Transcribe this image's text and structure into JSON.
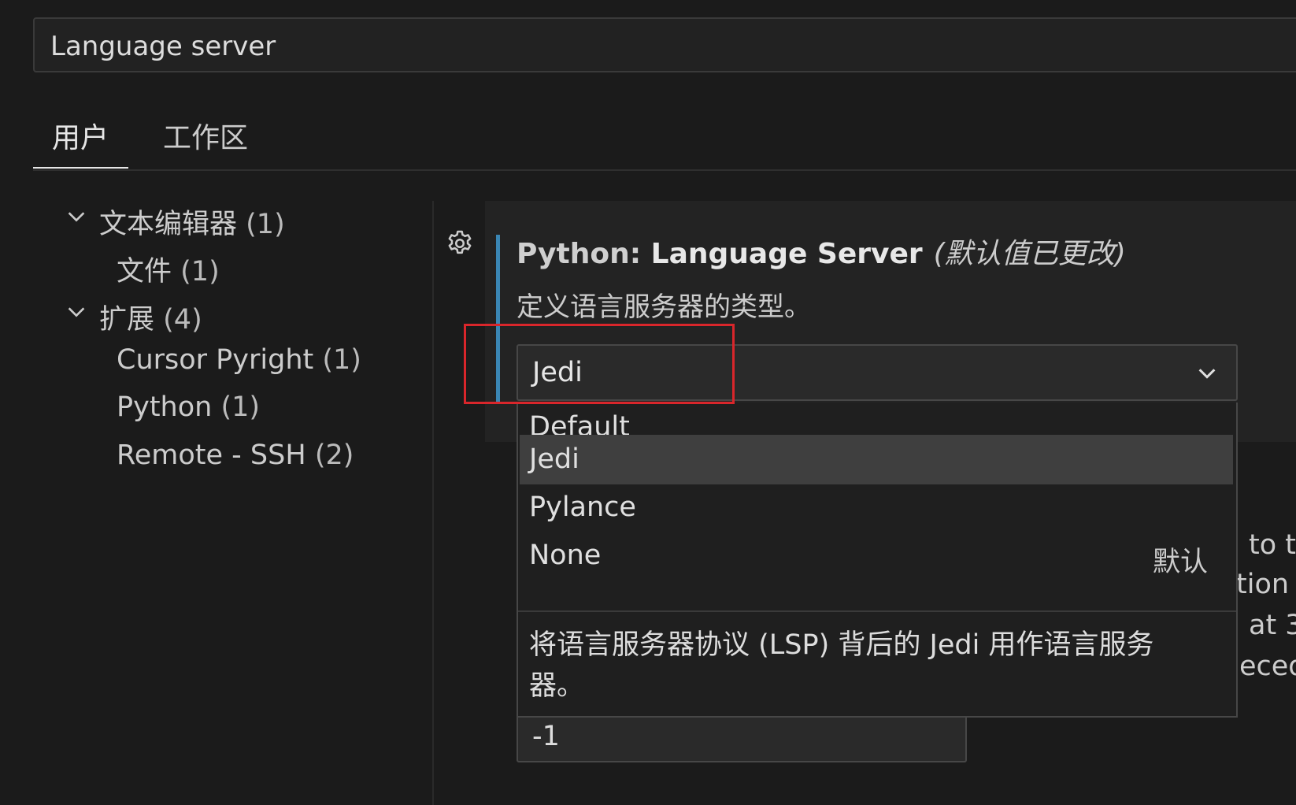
{
  "search": {
    "value": "Language server"
  },
  "tabs": [
    {
      "label": "用户",
      "active": true
    },
    {
      "label": "工作区",
      "active": false
    }
  ],
  "toc": {
    "groups": [
      {
        "label": "文本编辑器",
        "count": "(1)",
        "children": [
          {
            "label": "文件",
            "count": "(1)"
          }
        ]
      },
      {
        "label": "扩展",
        "count": "(4)",
        "children": [
          {
            "label": "Cursor Pyright",
            "count": "(1)"
          },
          {
            "label": "Python",
            "count": "(1)"
          },
          {
            "label": "Remote - SSH",
            "count": "(2)"
          }
        ]
      }
    ]
  },
  "setting": {
    "category": "Python: ",
    "name": "Language Server",
    "modified": "(默认值已更改)",
    "description": "定义语言服务器的类型。",
    "selected": "Jedi",
    "options": [
      {
        "label": "Default",
        "tag": ""
      },
      {
        "label": "Jedi",
        "tag": ""
      },
      {
        "label": "Pylance",
        "tag": ""
      },
      {
        "label": "None",
        "tag": "默认"
      }
    ],
    "selected_description": "将语言服务器协议 (LSP) 背后的 Jedi 用作语言服务器。"
  },
  "background": {
    "fragments": [
      "to t",
      "tion",
      "at 3",
      "eced"
    ],
    "number_value": "-1"
  },
  "colors": {
    "accent_bar": "#3a86b4",
    "highlight": "#d9262b",
    "selected_option_bg": "#3f3f3f"
  },
  "icons": {
    "gear": "gear-icon",
    "chevron": "chevron-down-icon"
  }
}
